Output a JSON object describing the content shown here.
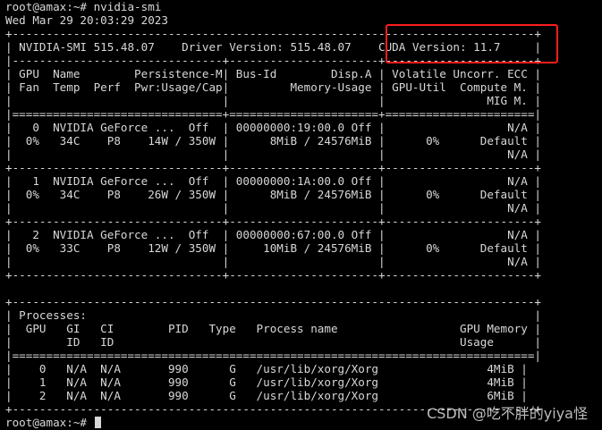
{
  "terminal": {
    "lines": [
      "root@amax:~# nvidia-smi",
      "Wed Mar 29 20:03:29 2023",
      "+-----------------------------------------------------------------------------+",
      "| NVIDIA-SMI 515.48.07    Driver Version: 515.48.07    CUDA Version: 11.7     |",
      "|-------------------------------+----------------------+----------------------+",
      "| GPU  Name        Persistence-M| Bus-Id        Disp.A | Volatile Uncorr. ECC |",
      "| Fan  Temp  Perf  Pwr:Usage/Cap|         Memory-Usage | GPU-Util  Compute M. |",
      "|                               |                      |               MIG M. |",
      "|===============================+======================+======================|",
      "|   0  NVIDIA GeForce ...  Off  | 00000000:19:00.0 Off |                  N/A |",
      "|  0%   34C    P8    14W / 350W |      8MiB / 24576MiB |      0%      Default |",
      "|                               |                      |                  N/A |",
      "+-------------------------------+----------------------+----------------------+",
      "|   1  NVIDIA GeForce ...  Off  | 00000000:1A:00.0 Off |                  N/A |",
      "|  0%   34C    P8    26W / 350W |      8MiB / 24576MiB |      0%      Default |",
      "|                               |                      |                  N/A |",
      "+-------------------------------+----------------------+----------------------+",
      "|   2  NVIDIA GeForce ...  Off  | 00000000:67:00.0 Off |                  N/A |",
      "|  0%   33C    P8    12W / 350W |     10MiB / 24576MiB |      0%      Default |",
      "|                               |                      |                  N/A |",
      "+-------------------------------+----------------------+----------------------+",
      "",
      "+-----------------------------------------------------------------------------+",
      "| Processes:                                                                  |",
      "|  GPU   GI   CI        PID   Type   Process name                  GPU Memory |",
      "|        ID   ID                                                   Usage      |",
      "|=============================================================================|",
      "|    0   N/A  N/A       990      G   /usr/lib/xorg/Xorg                4MiB |",
      "|    1   N/A  N/A       990      G   /usr/lib/xorg/Xorg                4MiB |",
      "|    2   N/A  N/A       990      G   /usr/lib/xorg/Xorg                6MiB |",
      "+-----------------------------------------------------------------------------+"
    ],
    "prompt": "root@amax:~# "
  },
  "watermark": "CSDN @吃不胖的yiya怪",
  "colors": {
    "background": "#000000",
    "foreground": "#d8d8d8",
    "highlight_border": "#ff1e1e"
  }
}
